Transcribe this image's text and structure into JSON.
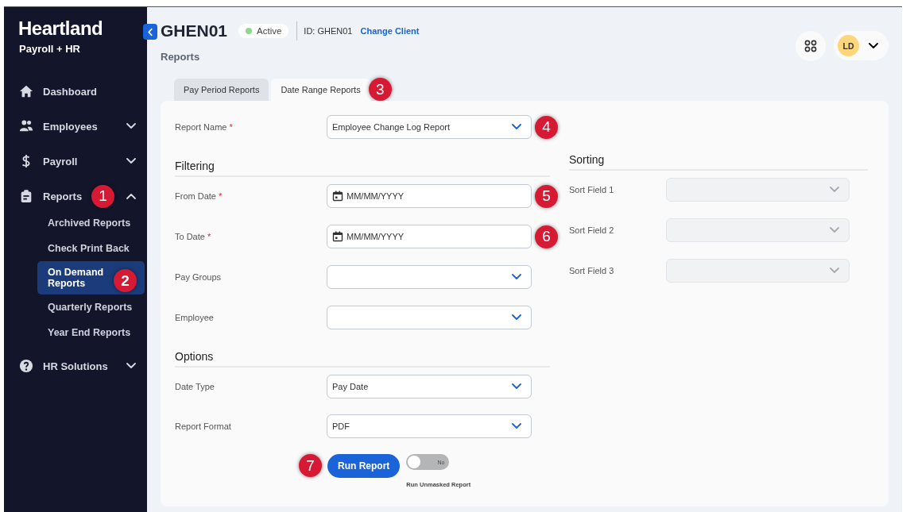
{
  "sidebar": {
    "brand": "Heartland",
    "subtitle": "Payroll + HR",
    "items": [
      {
        "label": "Dashboard"
      },
      {
        "label": "Employees",
        "expanded": false
      },
      {
        "label": "Payroll",
        "expanded": false
      },
      {
        "label": "Reports",
        "expanded": true,
        "step": "1",
        "children": [
          {
            "label": "Archived Reports",
            "selected": false
          },
          {
            "label": "Check Print Back",
            "selected": false
          },
          {
            "label": "On Demand Reports",
            "selected": true,
            "step": "2"
          },
          {
            "label": "Quarterly Reports",
            "selected": false
          },
          {
            "label": "Year End Reports",
            "selected": false
          }
        ]
      },
      {
        "label": "HR Solutions",
        "expanded": false
      }
    ]
  },
  "header": {
    "title": "GHEN01",
    "status": "Active",
    "client_id": "ID: GHEN01",
    "link": "Change Client",
    "subtitle": "Reports",
    "avatar": "LD"
  },
  "tabs": [
    {
      "label": "Pay Period Reports",
      "selected": false
    },
    {
      "label": "Date Range Reports",
      "selected": true,
      "step": "3"
    }
  ],
  "report_name": {
    "label": "Report Name",
    "required_mark": "*",
    "value": "Employee Change Log Report",
    "step": "4"
  },
  "filtering": {
    "heading": "Filtering",
    "fields": [
      {
        "label": "From Date",
        "required_mark": "*",
        "kind": "date",
        "placeholder": "MM/MM/YYYY",
        "step": "5"
      },
      {
        "label": "To Date",
        "required_mark": "*",
        "kind": "date",
        "placeholder": "MM/MM/YYYY",
        "step": "6"
      },
      {
        "label": "Pay Groups",
        "kind": "select"
      },
      {
        "label": "Employee",
        "kind": "select"
      }
    ]
  },
  "sorting": {
    "heading": "Sorting",
    "fields": [
      {
        "label": "Sort Field 1",
        "disabled": true
      },
      {
        "label": "Sort Field 2",
        "disabled": true
      },
      {
        "label": "Sort Field 3",
        "disabled": true
      }
    ]
  },
  "options": {
    "heading": "Options",
    "fields": [
      {
        "label": "Date Type",
        "kind": "select",
        "value": "Pay Date"
      },
      {
        "label": "Report Format",
        "kind": "select",
        "value": "PDF"
      }
    ]
  },
  "run_button": {
    "label": "Run Report",
    "step": "7"
  },
  "unmasked_toggle": {
    "on": false,
    "text": "No",
    "caption": "Run Unmasked Report"
  }
}
